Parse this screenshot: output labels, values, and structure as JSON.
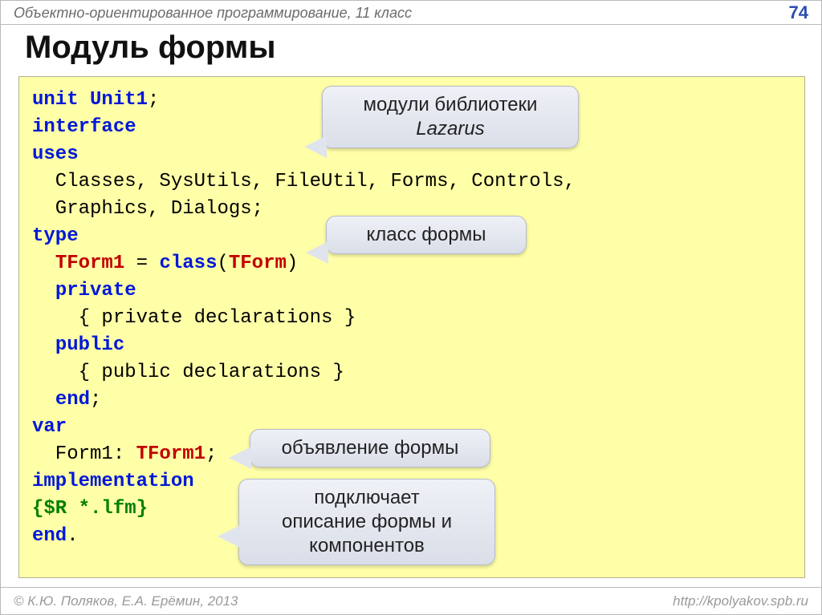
{
  "header": {
    "course": "Объектно-ориентированное программирование, 11 класс",
    "page": "74"
  },
  "title": "Модуль формы",
  "code": {
    "l1a": "unit",
    "l1b": "Unit1",
    "l1c": ";",
    "l2": "interface",
    "l3": "uses",
    "l4": "  Classes, SysUtils, FileUtil, Forms, Controls,",
    "l5": "  Graphics, Dialogs;",
    "l6": "type",
    "l7a": "  ",
    "l7b": "TForm1",
    "l7c": " = ",
    "l7d": "class",
    "l7e": "(",
    "l7f": "TForm",
    "l7g": ")",
    "l8": "private",
    "l8i": "  ",
    "l9": "    { private declarations }",
    "l10": "public",
    "l10i": "  ",
    "l11": "    { public declarations }",
    "l12": "end",
    "l12i": "  ",
    "l12c": ";",
    "l13": "var",
    "l14a": "  Form1: ",
    "l14b": "TForm1",
    "l14c": ";",
    "l15": "implementation",
    "l16": "{$R *.lfm}",
    "l17a": "end",
    "l17b": "."
  },
  "callouts": {
    "c1_line1": "модули библиотеки",
    "c1_line2": "Lazarus",
    "c2": "класс формы",
    "c3": "объявление формы",
    "c4_line1": "подключает",
    "c4_line2": "описание формы и",
    "c4_line3": "компонентов"
  },
  "footer": {
    "left": "© К.Ю. Поляков, Е.А. Ерёмин, 2013",
    "right": "http://kpolyakov.spb.ru"
  }
}
